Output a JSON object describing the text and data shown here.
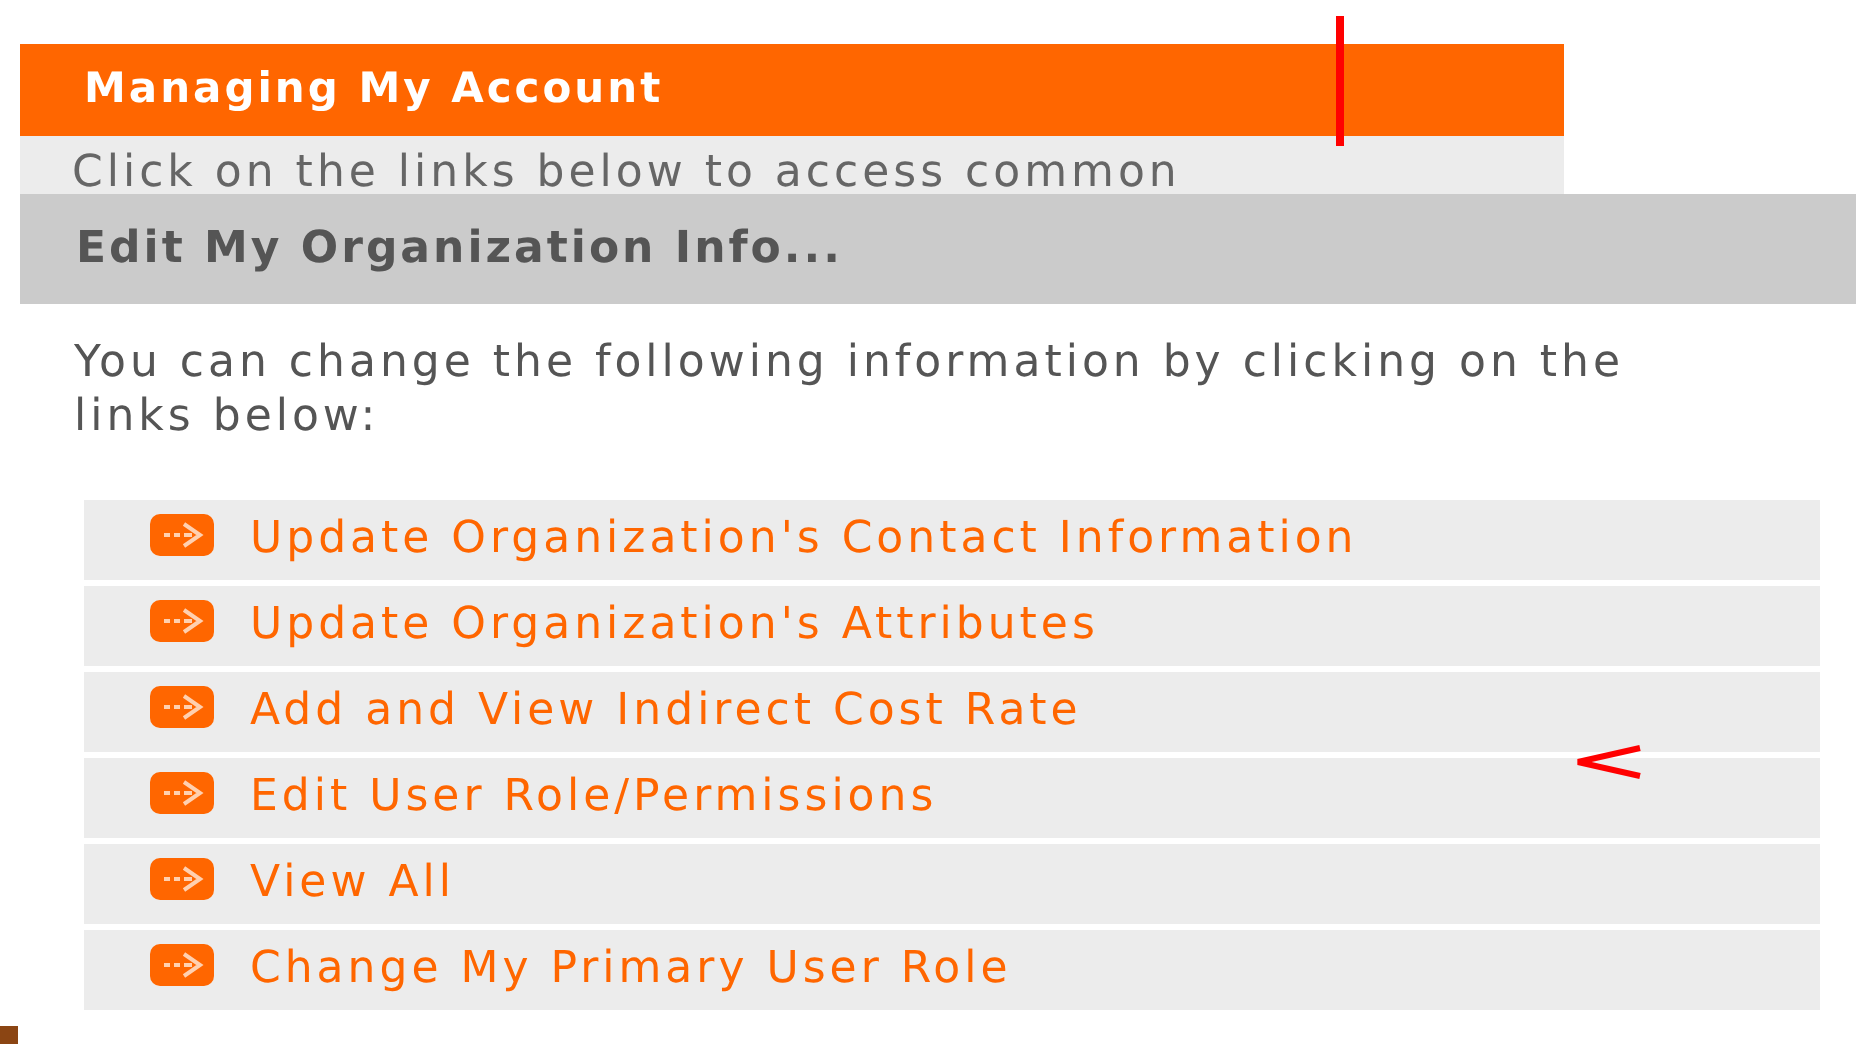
{
  "back_panel": {
    "title": "Managing My Account",
    "text": "Click on the links below to access common"
  },
  "panel": {
    "title": "Edit My Organization Info...",
    "intro": "You can change the following information by clicking on the links below:",
    "links": [
      {
        "label": "Update Organization's Contact Information"
      },
      {
        "label": "Update Organization's Attributes"
      },
      {
        "label": "Add and View Indirect Cost Rate"
      },
      {
        "label": "Edit User Role/Permissions"
      },
      {
        "label": "View All"
      },
      {
        "label": "Change My Primary User Role"
      }
    ]
  }
}
